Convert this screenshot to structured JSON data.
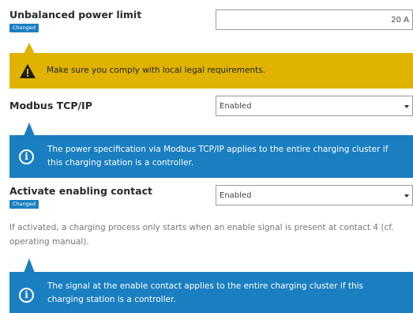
{
  "unbalanced": {
    "label": "Unbalanced power limit",
    "badge": "Changed",
    "value": "20 A"
  },
  "warning": {
    "text": "Make sure you comply with local legal requirements.",
    "icon": "warning-triangle-icon"
  },
  "modbus": {
    "label": "Modbus TCP/IP",
    "value": "Enabled",
    "info": "The power specification via Modbus TCP/IP applies to the entire charging cluster if this charging station is a controller."
  },
  "enabling": {
    "label": "Activate enabling contact",
    "badge": "Changed",
    "value": "Enabled",
    "help": "If activated, a charging process only starts when an enable signal is present at contact 4 (cf. operating manual).",
    "info": "The signal at the enable contact applies to the entire charging cluster if this charging station is a controller."
  },
  "colors": {
    "accent_blue": "#1a7fc1",
    "warning_yellow": "#e0b300"
  }
}
